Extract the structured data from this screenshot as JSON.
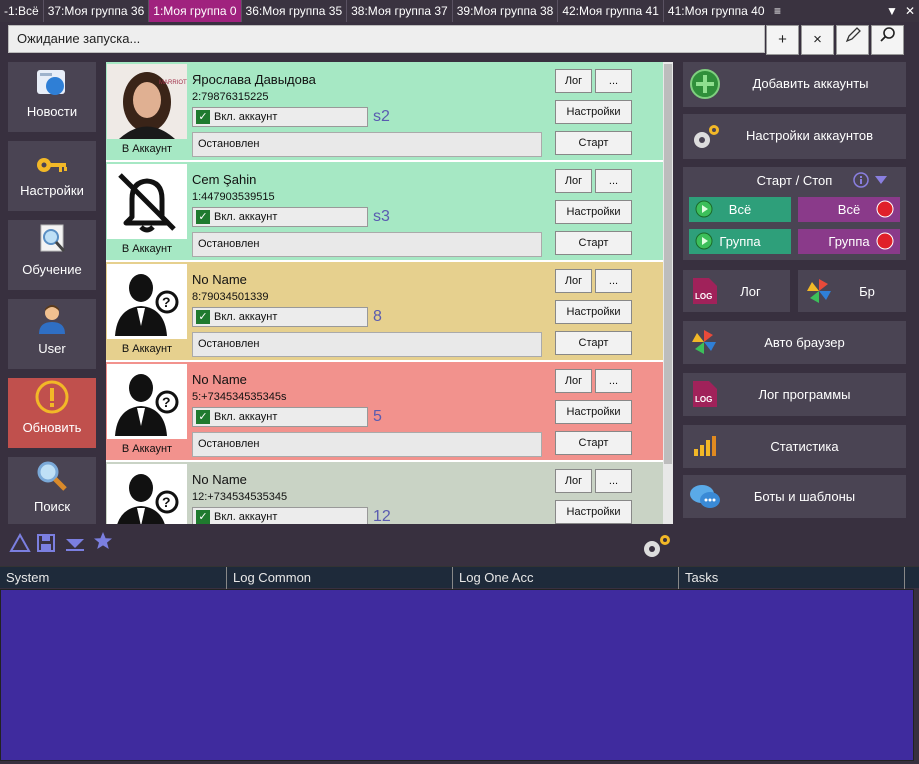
{
  "tabs": [
    {
      "label": "-1:Всё",
      "active": false
    },
    {
      "label": "37:Моя группа 36",
      "active": false
    },
    {
      "label": "1:Моя группа 0",
      "active": true
    },
    {
      "label": "36:Моя группа 35",
      "active": false
    },
    {
      "label": "38:Моя группа 37",
      "active": false
    },
    {
      "label": "39:Моя группа 38",
      "active": false
    },
    {
      "label": "42:Моя группа 41",
      "active": false
    },
    {
      "label": "41:Моя группа 40",
      "active": false
    }
  ],
  "tab_controls": {
    "menu": "≡",
    "dropdown": "▼",
    "close": "✕"
  },
  "status": {
    "text": "Ожидание запуска..."
  },
  "top_buttons": {
    "add": "+",
    "close": "×",
    "edit": "✎",
    "search": "⚲"
  },
  "nav": [
    {
      "label": "Новости",
      "icon": "news-icon"
    },
    {
      "label": "Настройки",
      "icon": "key-icon"
    },
    {
      "label": "Обучение",
      "icon": "magnifier-doc-icon"
    },
    {
      "label": "User",
      "icon": "user-icon"
    },
    {
      "label": "Обновить",
      "icon": "warning-icon"
    },
    {
      "label": "Поиск",
      "icon": "search-icon"
    }
  ],
  "accounts": [
    {
      "name": "Ярослава Давыдова",
      "phone": "2:79876315225",
      "enable": "Вкл. аккаунт",
      "tag": "s2",
      "state": "Остановлен",
      "in_acc": "В Аккаунт",
      "color": "#a6e8c4",
      "icon": "photo-avatar-icon"
    },
    {
      "name": "Cem Şahin",
      "phone": "1:447903539515",
      "enable": "Вкл. аккаунт",
      "tag": "s3",
      "state": "Остановлен",
      "in_acc": "В Аккаунт",
      "color": "#a6e8c4",
      "icon": "bell-off-icon"
    },
    {
      "name": "No Name",
      "phone": "8:79034501339",
      "enable": "Вкл. аккаунт",
      "tag": "8",
      "state": "Остановлен",
      "in_acc": "В Аккаунт",
      "color": "#e6d08e",
      "icon": "unknown-user-icon"
    },
    {
      "name": "No Name",
      "phone": "5:+734534535345s",
      "enable": "Вкл. аккаунт",
      "tag": "5",
      "state": "Остановлен",
      "in_acc": "В Аккаунт",
      "color": "#f2928d",
      "icon": "unknown-user-icon"
    },
    {
      "name": "No Name",
      "phone": "12:+734534535345",
      "enable": "Вкл. аккаунт",
      "tag": "12",
      "state": "",
      "in_acc": "",
      "color": "#c9d3c5",
      "icon": "unknown-user-icon"
    }
  ],
  "row_buttons": {
    "log": "Лог",
    "more": "...",
    "settings": "Настройки",
    "start": "Старт"
  },
  "right": {
    "add_accounts": "Добавить аккаунты",
    "acc_settings": "Настройки аккаунтов",
    "startstop_title": "Старт / Стоп",
    "start_all": "Всё",
    "stop_all": "Всё",
    "start_group": "Группа",
    "stop_group": "Группа",
    "log": "Лог",
    "br": "Бр",
    "auto_browser": "Авто браузер",
    "program_log": "Лог программы",
    "stats": "Статистика",
    "bots": "Боты и шаблоны"
  },
  "log_tabs": [
    "System",
    "Log Common",
    "Log One Acc",
    "Tasks"
  ],
  "colors": {
    "active_tab": "#a0227e",
    "green_btn": "#2e9f7a",
    "purple_btn": "#8a3a8a",
    "log_bg": "#3f2b9e",
    "panel": "#4a4453"
  }
}
